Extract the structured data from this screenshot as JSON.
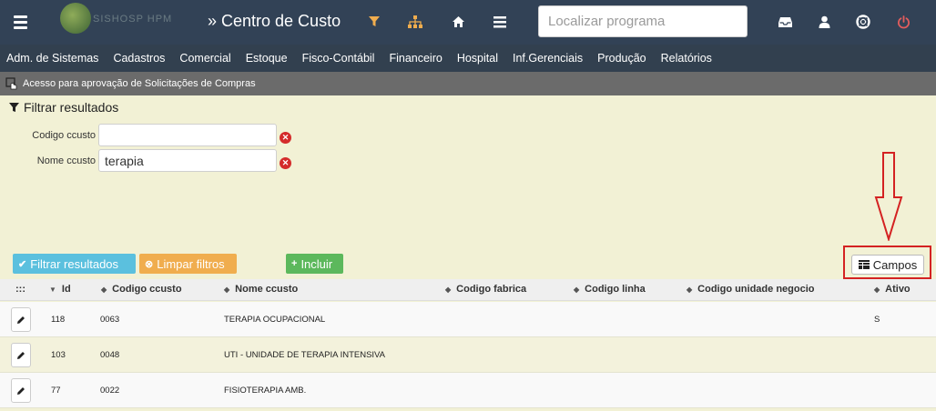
{
  "header": {
    "title": "» Centro de Custo",
    "logo_text": "SISHOSP HPM",
    "search_placeholder": "Localizar programa",
    "colors": {
      "background": "#324256",
      "accent_icons": "#f0ad4e",
      "power_icon": "#e35d5d"
    }
  },
  "menu": {
    "items": [
      "Adm. de Sistemas",
      "Cadastros",
      "Comercial",
      "Estoque",
      "Fisco-Contábil",
      "Financeiro",
      "Hospital",
      "Inf.Gerenciais",
      "Produção",
      "Relatórios"
    ]
  },
  "notice": {
    "text": "Acesso para aprovação de Solicitações de Compras"
  },
  "filter": {
    "heading": "Filtrar resultados",
    "fields": [
      {
        "label": "Codigo ccusto",
        "value": ""
      },
      {
        "label": "Nome ccusto",
        "value": "terapia"
      }
    ]
  },
  "buttons": {
    "filter": "Filtrar resultados",
    "clear": "Limpar filtros",
    "add": "Incluir",
    "fields": "Campos"
  },
  "table": {
    "handle": ":::",
    "columns": [
      "Id",
      "Codigo ccusto",
      "Nome ccusto",
      "Codigo fabrica",
      "Codigo linha",
      "Codigo unidade negocio",
      "Ativo"
    ],
    "rows": [
      {
        "id": "118",
        "codigo": "0063",
        "nome": "TERAPIA OCUPACIONAL",
        "fabrica": "",
        "linha": "",
        "unidade": "",
        "ativo": "S"
      },
      {
        "id": "103",
        "codigo": "0048",
        "nome": "UTI - UNIDADE DE TERAPIA INTENSIVA",
        "fabrica": "",
        "linha": "",
        "unidade": "",
        "ativo": ""
      },
      {
        "id": "77",
        "codigo": "0022",
        "nome": "FISIOTERAPIA AMB.",
        "fabrica": "",
        "linha": "",
        "unidade": "",
        "ativo": ""
      }
    ]
  },
  "icons": {
    "topbar": [
      "menu-icon",
      "filter-icon",
      "sitemap-icon",
      "home-icon",
      "list-icon",
      "inbox-icon",
      "user-icon",
      "lifebuoy-icon",
      "power-icon"
    ],
    "edit": "pencil-icon",
    "fields": "columns-icon"
  }
}
